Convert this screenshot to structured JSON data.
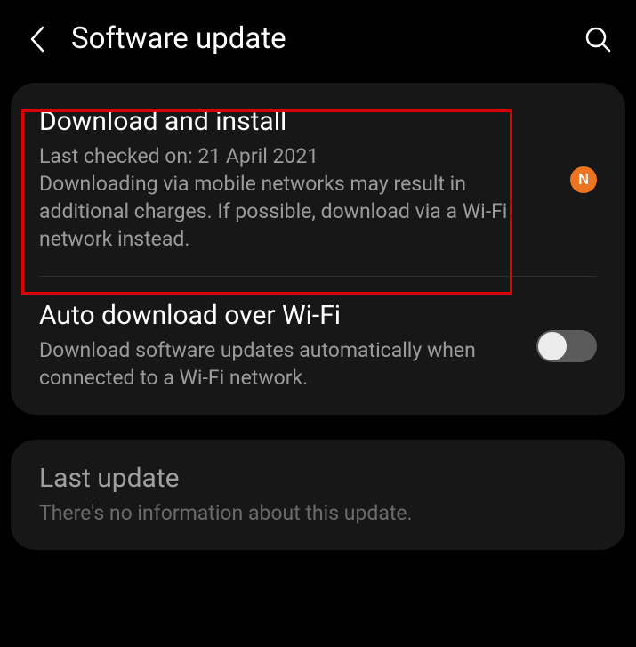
{
  "header": {
    "title": "Software update"
  },
  "items": {
    "download": {
      "title": "Download and install",
      "subtitle": "Last checked on: 21 April 2021\nDownloading via mobile networks may result in additional charges. If possible, download via a Wi-Fi network instead.",
      "badge": "N"
    },
    "auto": {
      "title": "Auto download over Wi-Fi",
      "subtitle": "Download software updates automatically when connected to a Wi-Fi network.",
      "toggle": false
    },
    "last": {
      "title": "Last update",
      "subtitle": "There's no information about this update."
    }
  }
}
